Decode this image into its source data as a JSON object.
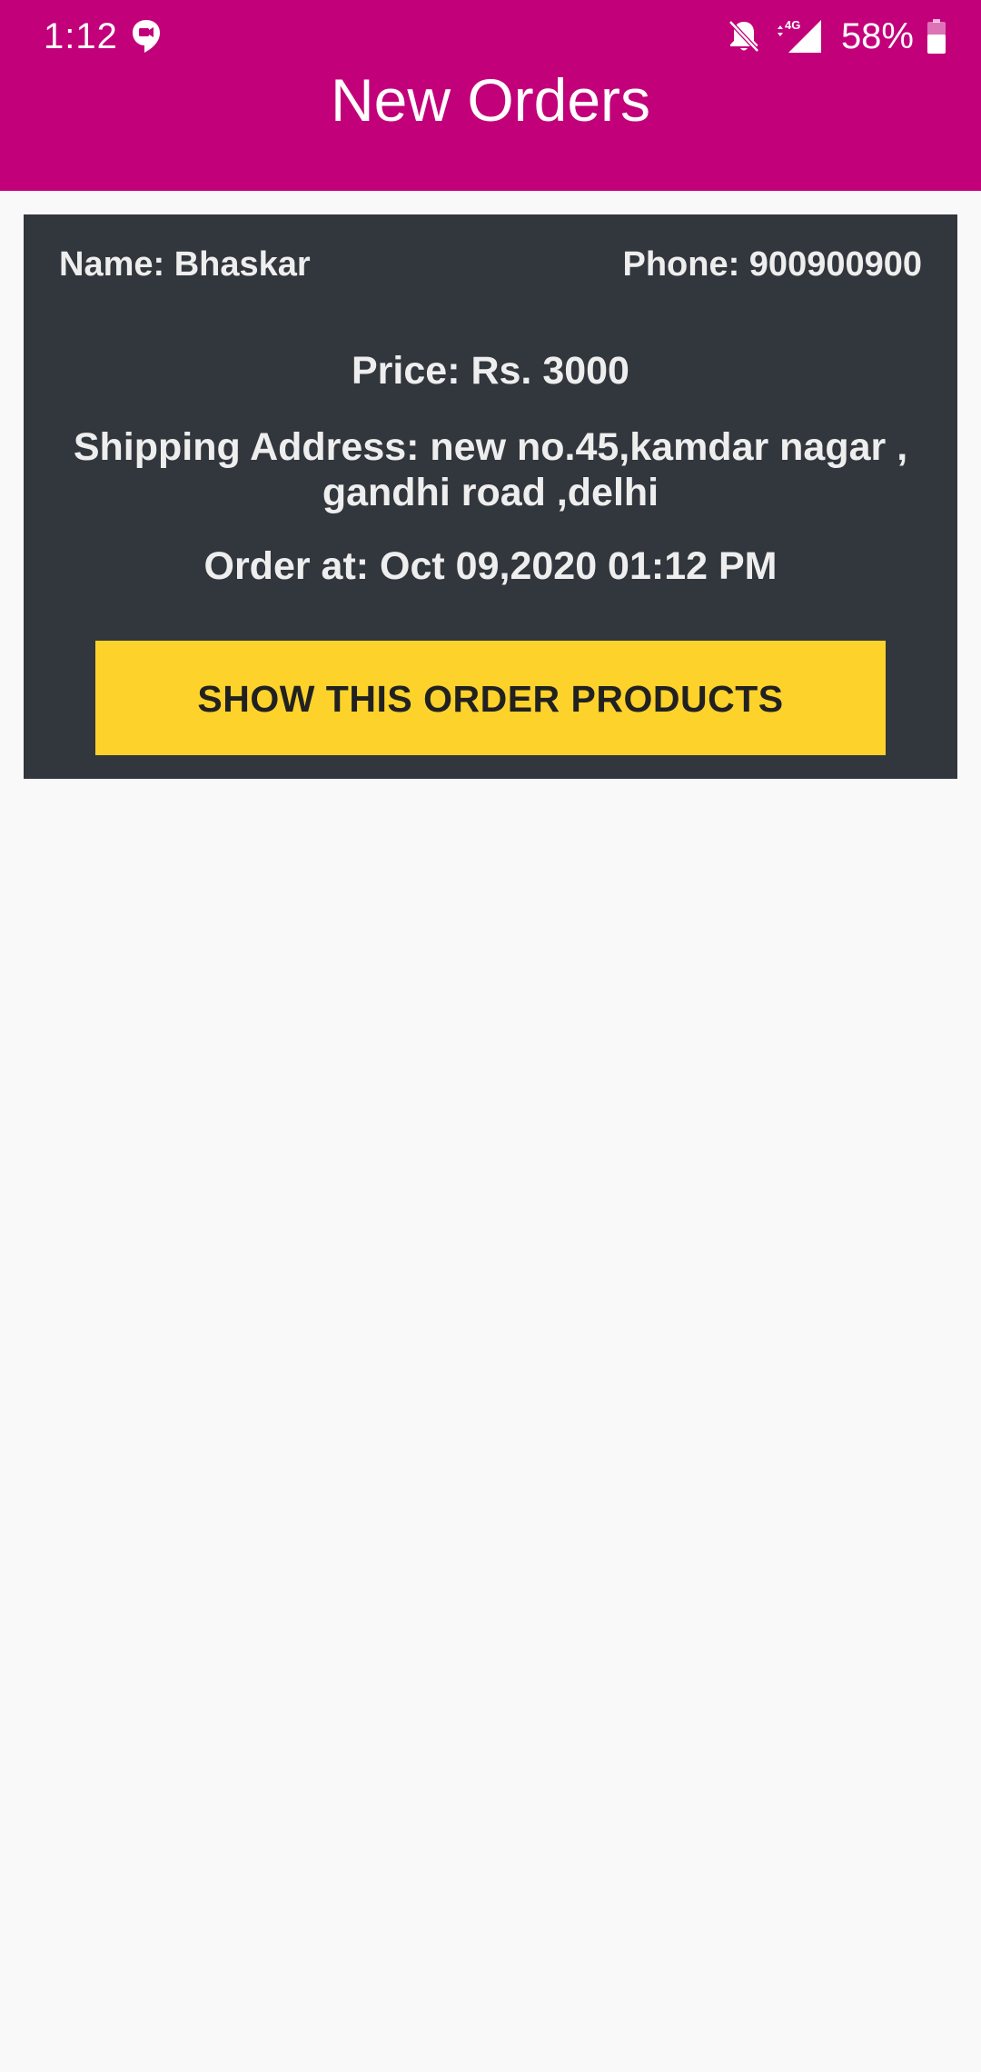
{
  "status_bar": {
    "time": "1:12",
    "network": "4G",
    "battery": "58%"
  },
  "header": {
    "title": "New Orders"
  },
  "orders": [
    {
      "name": "Name: Bhaskar",
      "phone": "Phone: 900900900",
      "price": "Price: Rs. 3000",
      "address": "Shipping Address: new no.45,kamdar nagar , gandhi road ,delhi",
      "order_at": "Order at: Oct 09,2020 01:12 PM",
      "button_label": "SHOW THIS ORDER PRODUCTS"
    }
  ],
  "colors": {
    "header": "#c2007a",
    "card": "#32373d",
    "button": "#fdd22b",
    "background": "#f9f9f9"
  },
  "icons": [
    "chat-icon",
    "bell-off-icon",
    "signal-icon",
    "battery-icon"
  ]
}
